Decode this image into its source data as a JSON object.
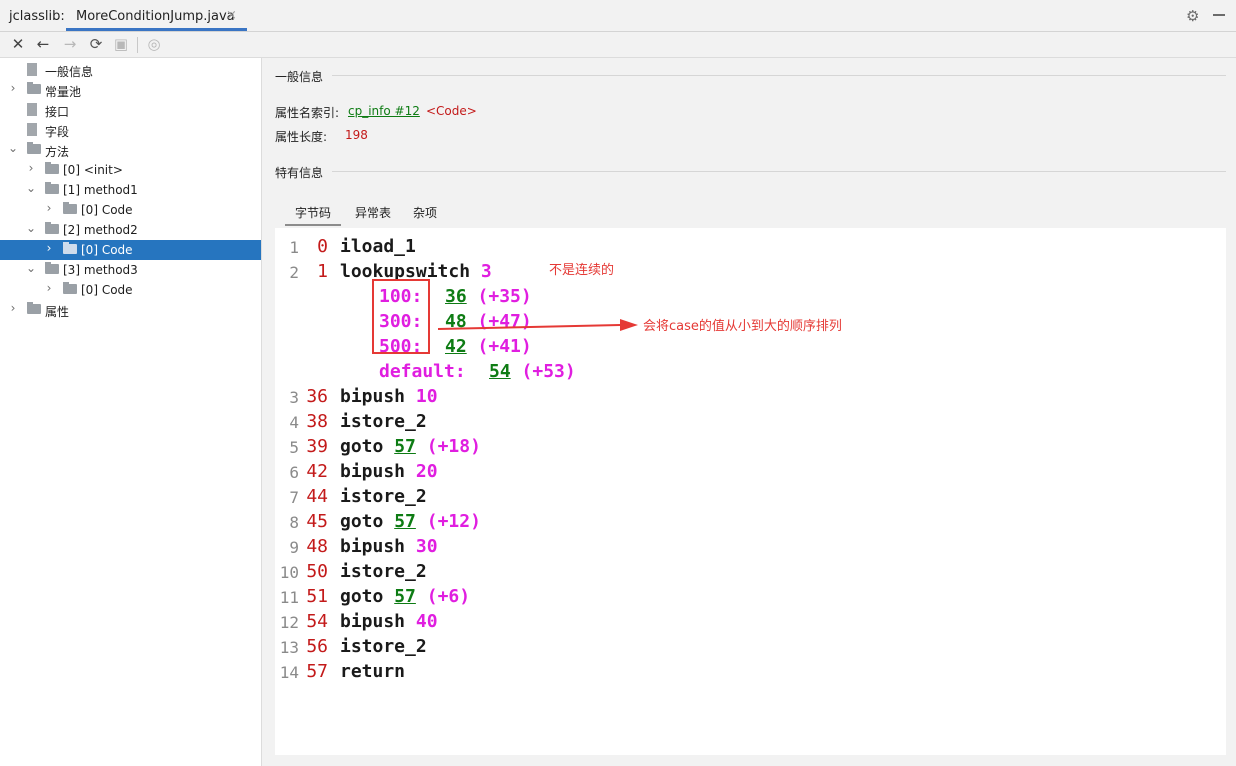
{
  "window": {
    "title_prefix": "jclasslib:",
    "tab_label": "MoreConditionJump.java",
    "tab_close": "×",
    "settings_icon": "gear-icon",
    "minimize_icon": "minus-icon"
  },
  "toolbar": {
    "close": "✕",
    "back": "←",
    "forward": "→",
    "refresh": "⟳",
    "save": "▣",
    "web": "◎"
  },
  "tree": [
    {
      "label": "一般信息",
      "type": "file",
      "level": 0,
      "arrow": ""
    },
    {
      "label": "常量池",
      "type": "folder",
      "level": 0,
      "arrow": "›"
    },
    {
      "label": "接口",
      "type": "file",
      "level": 0,
      "arrow": ""
    },
    {
      "label": "字段",
      "type": "file",
      "level": 0,
      "arrow": ""
    },
    {
      "label": "方法",
      "type": "folder",
      "level": 0,
      "arrow": "⌄"
    },
    {
      "label": "[0] <init>",
      "type": "folder",
      "level": 1,
      "arrow": "›"
    },
    {
      "label": "[1] method1",
      "type": "folder",
      "level": 1,
      "arrow": "⌄"
    },
    {
      "label": "[0] Code",
      "type": "folder",
      "level": 2,
      "arrow": "›"
    },
    {
      "label": "[2] method2",
      "type": "folder",
      "level": 1,
      "arrow": "⌄"
    },
    {
      "label": "[0] Code",
      "type": "folder",
      "level": 2,
      "arrow": "›",
      "selected": true
    },
    {
      "label": "[3] method3",
      "type": "folder",
      "level": 1,
      "arrow": "⌄"
    },
    {
      "label": "[0] Code",
      "type": "folder",
      "level": 2,
      "arrow": "›"
    },
    {
      "label": "属性",
      "type": "folder",
      "level": 0,
      "arrow": "›"
    }
  ],
  "general": {
    "section_title": "一般信息",
    "name_index_label": "属性名索引:",
    "name_index_link": "cp_info #12",
    "name_index_value": "<Code>",
    "length_label": "属性长度:",
    "length_value": "198"
  },
  "specific": {
    "section_title": "特有信息",
    "tabs": [
      "字节码",
      "异常表",
      "杂项"
    ],
    "active_tab": 0
  },
  "bytecode": [
    {
      "ln": "1",
      "off": "0",
      "op": "iload_1"
    },
    {
      "ln": "2",
      "off": "1",
      "op": "lookupswitch",
      "arg": "3"
    },
    {
      "ln": "3",
      "off": "36",
      "op": "bipush",
      "arg": "10"
    },
    {
      "ln": "4",
      "off": "38",
      "op": "istore_2"
    },
    {
      "ln": "5",
      "off": "39",
      "op": "goto",
      "target": "57",
      "rel": "(+18)"
    },
    {
      "ln": "6",
      "off": "42",
      "op": "bipush",
      "arg": "20"
    },
    {
      "ln": "7",
      "off": "44",
      "op": "istore_2"
    },
    {
      "ln": "8",
      "off": "45",
      "op": "goto",
      "target": "57",
      "rel": "(+12)"
    },
    {
      "ln": "9",
      "off": "48",
      "op": "bipush",
      "arg": "30"
    },
    {
      "ln": "10",
      "off": "50",
      "op": "istore_2"
    },
    {
      "ln": "11",
      "off": "51",
      "op": "goto",
      "target": "57",
      "rel": "(+6)"
    },
    {
      "ln": "12",
      "off": "54",
      "op": "bipush",
      "arg": "40"
    },
    {
      "ln": "13",
      "off": "56",
      "op": "istore_2"
    },
    {
      "ln": "14",
      "off": "57",
      "op": "return"
    }
  ],
  "switch_cases": [
    {
      "key": "100:",
      "target": "36",
      "rel": "(+35)"
    },
    {
      "key": "300:",
      "target": "48",
      "rel": "(+47)"
    },
    {
      "key": "500:",
      "target": "42",
      "rel": "(+41)"
    }
  ],
  "switch_default": {
    "key": "default:",
    "target": "54",
    "rel": "(+53)"
  },
  "annotations": {
    "not_continuous": "不是连续的",
    "sorted_note": "会将case的值从小到大的顺序排列"
  }
}
